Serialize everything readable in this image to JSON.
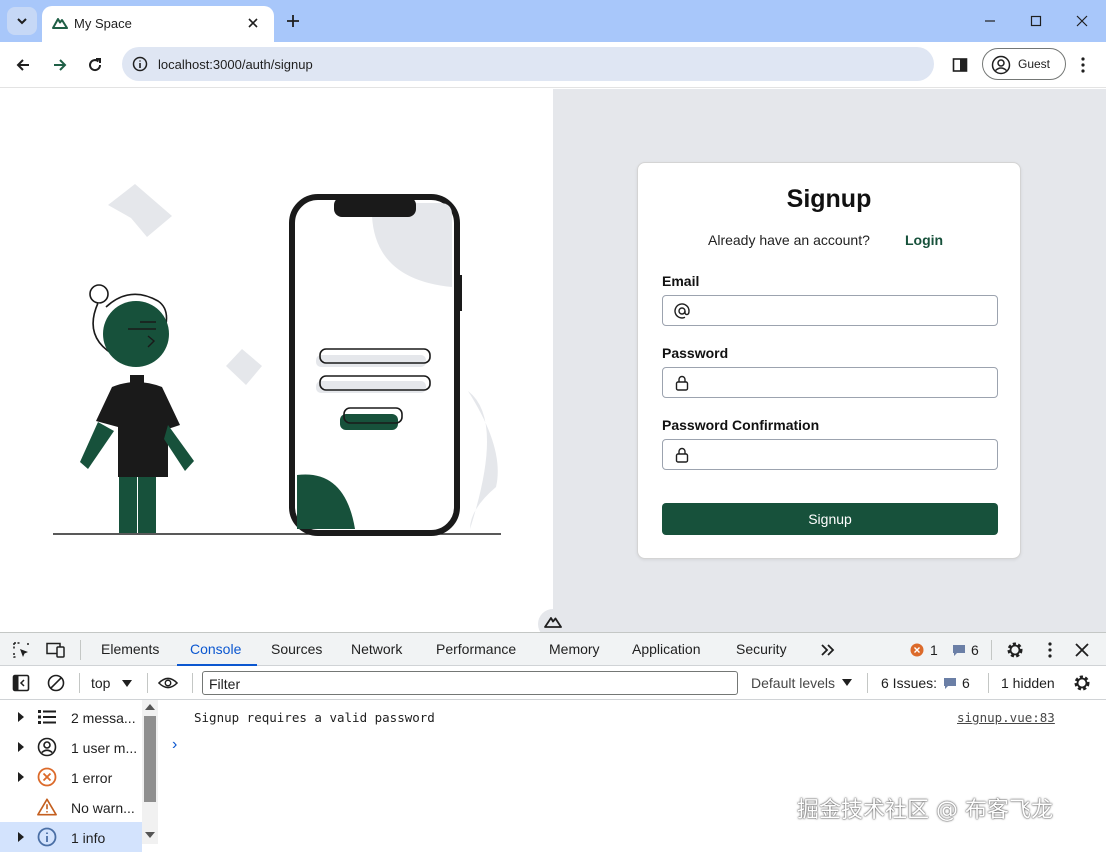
{
  "browser": {
    "tab_title": "My Space",
    "url": "localhost:3000/auth/signup",
    "profile_label": "Guest"
  },
  "signup": {
    "title": "Signup",
    "have_account": "Already have an account?",
    "login_link": "Login",
    "email_label": "Email",
    "email_value": "",
    "password_label": "Password",
    "password_value": "",
    "confirm_label": "Password Confirmation",
    "confirm_value": "",
    "submit_label": "Signup",
    "accent_color": "#17513b"
  },
  "devtools": {
    "tabs": [
      "Elements",
      "Console",
      "Sources",
      "Network",
      "Performance",
      "Memory",
      "Application",
      "Security"
    ],
    "active_tab": "Console",
    "error_count": "1",
    "message_count": "6",
    "context": "top",
    "filter_placeholder": "Filter",
    "levels": "Default levels",
    "issues_label": "6 Issues:",
    "issues_count": "6",
    "hidden": "1 hidden",
    "sidebar": [
      {
        "label": "2 messa...",
        "icon": "list-icon"
      },
      {
        "label": "1 user m...",
        "icon": "user-icon"
      },
      {
        "label": "1 error",
        "icon": "error-icon"
      },
      {
        "label": "No warn...",
        "icon": "warning-icon"
      },
      {
        "label": "1 info",
        "icon": "info-icon"
      }
    ],
    "message": "Signup requires a valid password",
    "message_source": "signup.vue:83",
    "prompt": "›"
  },
  "watermark": "掘金技术社区 @ 布客飞龙"
}
